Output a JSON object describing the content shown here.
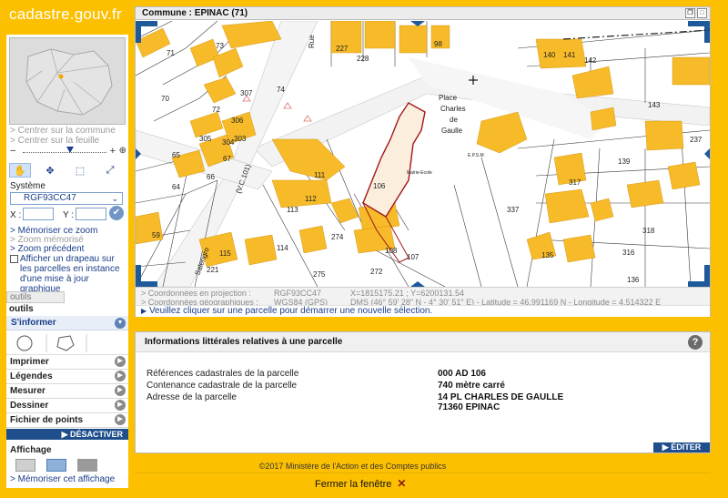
{
  "logo": {
    "text": "cadastre.gouv.fr"
  },
  "left_panel": {
    "links": {
      "center_commune": "> Centrer sur la commune",
      "center_feuille": "> Centrer sur la feuille",
      "memorize_zoom": "> Mémoriser ce zoom",
      "zoom_memorise": "> Zoom mémorisé",
      "zoom_precedent": "> Zoom précédent"
    },
    "systeme_label": "Système",
    "systeme_value": "RGF93CC47",
    "x_label": "X :",
    "y_label": "Y :",
    "flag_text": "Afficher un drapeau sur les parcelles en instance d'une mise à jour graphique",
    "tab_simple": "outils simples",
    "tab_advanced": "outils avancés",
    "sinformer": "S'informer",
    "menu": [
      "Imprimer",
      "Légendes",
      "Mesurer",
      "Dessiner",
      "Fichier de points"
    ],
    "desactiver": "DÉSACTIVER",
    "affichage": "Affichage",
    "memorize_display": "> Mémoriser cet affichage"
  },
  "map": {
    "title": "Commune : EPINAC (71)",
    "labels": {
      "place": "Place",
      "charles": "Charles",
      "de": "de",
      "gaulle": "Gaulle",
      "rue": "Rue",
      "salengro": "Salengro",
      "vc101": "(V.C.101)",
      "mairie": "Mairie-Ecole",
      "ep": "E.P.S.M"
    },
    "parcels": [
      "71",
      "73",
      "72",
      "74",
      "70",
      "307",
      "305",
      "306",
      "304",
      "303",
      "67",
      "66",
      "65",
      "64",
      "59",
      "111",
      "112",
      "113",
      "114",
      "115",
      "221",
      "275",
      "274",
      "108",
      "107",
      "272",
      "106",
      "227",
      "228",
      "98",
      "140",
      "141",
      "142",
      "143",
      "237",
      "139",
      "317",
      "318",
      "337",
      "135",
      "316",
      "136"
    ],
    "coords": {
      "proj_label": "> Coordonnées en projection :",
      "proj_sys": "RGF93CC47",
      "proj_val": "X=1815175.21 ; Y=6200131.54",
      "geo_label": "> Coordonnées géographiques :",
      "geo_sys": "WGS84 (GPS)",
      "geo_val": "DMS (46° 59' 28\" N - 4° 30' 51\" E) - Latitude = 46.991169 N - Longitude = 4.514322 E"
    },
    "hint": "Veuillez cliquer sur une parcelle pour démarrer une nouvelle sélection."
  },
  "info": {
    "title": "Informations littérales relatives à une parcelle",
    "rows": [
      {
        "label": "Références cadastrales de la parcelle",
        "value": "000 AD 106"
      },
      {
        "label": "Contenance cadastrale de la parcelle",
        "value": "740 mètre carré"
      },
      {
        "label": "Adresse de la parcelle",
        "value": "14 PL CHARLES DE GAULLE",
        "value2": "71360 EPINAC"
      }
    ],
    "editer": "ÉDITER"
  },
  "footer": {
    "copyright": "©2017 Ministère de l'Action et des Comptes publics",
    "close": "Fermer la fenêtre"
  },
  "colors": {
    "building": "#f7bb2a",
    "accent": "#1e4f8c",
    "background": "#fcc000"
  }
}
